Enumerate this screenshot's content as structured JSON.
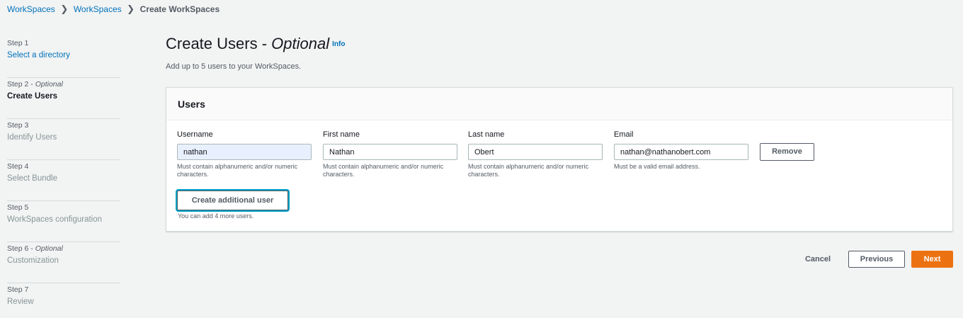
{
  "breadcrumb": {
    "items": [
      "WorkSpaces",
      "WorkSpaces",
      "Create WorkSpaces"
    ],
    "separator": ">"
  },
  "steps": [
    {
      "num": "Step 1",
      "title": "Select a directory"
    },
    {
      "num": "Step 2 - ",
      "optional": "Optional",
      "title": "Create Users"
    },
    {
      "num": "Step 3",
      "title": "Identify Users"
    },
    {
      "num": "Step 4",
      "title": "Select Bundle"
    },
    {
      "num": "Step 5",
      "title": "WorkSpaces configuration"
    },
    {
      "num": "Step 6 - ",
      "optional": "Optional",
      "title": "Customization"
    },
    {
      "num": "Step 7",
      "title": "Review"
    }
  ],
  "main": {
    "title": "Create Users - ",
    "title_optional": "Optional",
    "info": "Info",
    "subtitle": "Add up to 5 users to your WorkSpaces."
  },
  "users_panel": {
    "title": "Users",
    "fields": {
      "username": {
        "label": "Username",
        "value": "nathan",
        "hint": "Must contain alphanumeric and/or numeric characters."
      },
      "first_name": {
        "label": "First name",
        "value": "Nathan",
        "hint": "Must contain alphanumeric and/or numeric characters."
      },
      "last_name": {
        "label": "Last name",
        "value": "Obert",
        "hint": "Must contain alphanumeric and/or numeric characters."
      },
      "email": {
        "label": "Email",
        "value": "nathan@nathanobert.com",
        "hint": "Must be a valid email address."
      }
    },
    "remove_label": "Remove",
    "add_user_label": "Create additional user",
    "add_hint": "You can add 4 more users."
  },
  "actions": {
    "cancel": "Cancel",
    "previous": "Previous",
    "next": "Next"
  },
  "colors": {
    "link": "#0073bb",
    "primary": "#ec7211",
    "focus": "#00a1c9",
    "background": "#f2f3f3"
  }
}
